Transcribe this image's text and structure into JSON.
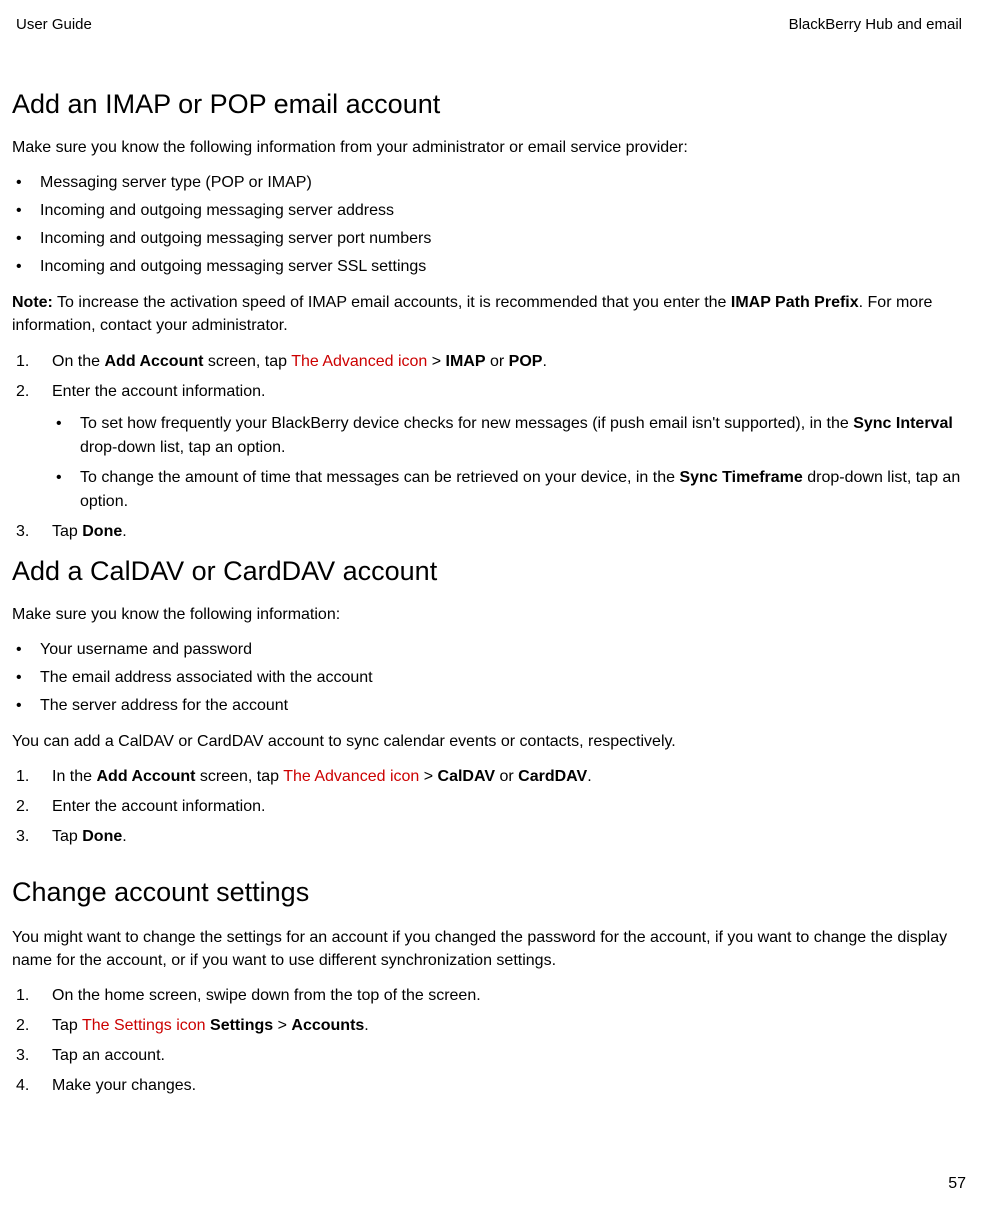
{
  "header": {
    "left": "User Guide",
    "right": "BlackBerry Hub and email"
  },
  "s1": {
    "title": "Add an IMAP or POP email account",
    "intro": "Make sure you know the following information from your administrator or email service provider:",
    "bullets": [
      "Messaging server type (POP or IMAP)",
      "Incoming and outgoing messaging server address",
      "Incoming and outgoing messaging server port numbers",
      "Incoming and outgoing messaging server SSL settings"
    ],
    "note_label": "Note:",
    "note_text1": " To increase the activation speed of IMAP email accounts, it is recommended that you enter the ",
    "note_bold": "IMAP Path Prefix",
    "note_text2": ". For more information, contact your administrator.",
    "step1_a": "On the ",
    "step1_b": "Add Account",
    "step1_c": " screen, tap  ",
    "step1_red": "The Advanced icon",
    "step1_d": "  > ",
    "step1_e": "IMAP",
    "step1_f": " or ",
    "step1_g": "POP",
    "step1_h": ".",
    "step2": "Enter the account information.",
    "sub1_a": "To set how frequently your BlackBerry device checks for new messages (if push email isn't supported), in the ",
    "sub1_b": "Sync Interval",
    "sub1_c": " drop-down list, tap an option.",
    "sub2_a": "To change the amount of time that messages can be retrieved on your device, in the ",
    "sub2_b": "Sync Timeframe",
    "sub2_c": " drop-down list, tap an option.",
    "step3_a": "Tap ",
    "step3_b": "Done",
    "step3_c": "."
  },
  "s2": {
    "title": "Add a CalDAV or CardDAV account",
    "intro": "Make sure you know the following information:",
    "bullets": [
      "Your username and password",
      "The email address associated with the account",
      "The server address for the account"
    ],
    "desc": "You can add a CalDAV or CardDAV account to sync calendar events or contacts, respectively.",
    "step1_a": "In the ",
    "step1_b": "Add Account",
    "step1_c": " screen, tap  ",
    "step1_red": "The Advanced icon",
    "step1_d": "  > ",
    "step1_e": "CalDAV",
    "step1_f": " or ",
    "step1_g": "CardDAV",
    "step1_h": ".",
    "step2": "Enter the account information.",
    "step3_a": "Tap ",
    "step3_b": "Done",
    "step3_c": "."
  },
  "s3": {
    "title": "Change account settings",
    "intro": "You might want to change the settings for an account if you changed the password for the account, if you want to change the display name for the account, or if you want to use different synchronization settings.",
    "step1": "On the home screen, swipe down from the top of the screen.",
    "step2_a": "Tap  ",
    "step2_red": "The Settings icon",
    "step2_b": "  ",
    "step2_c": "Settings",
    "step2_d": " > ",
    "step2_e": "Accounts",
    "step2_f": ".",
    "step3": "Tap an account.",
    "step4": "Make your changes."
  },
  "page": "57",
  "nums": {
    "n1": "1.",
    "n2": "2.",
    "n3": "3.",
    "n4": "4."
  }
}
